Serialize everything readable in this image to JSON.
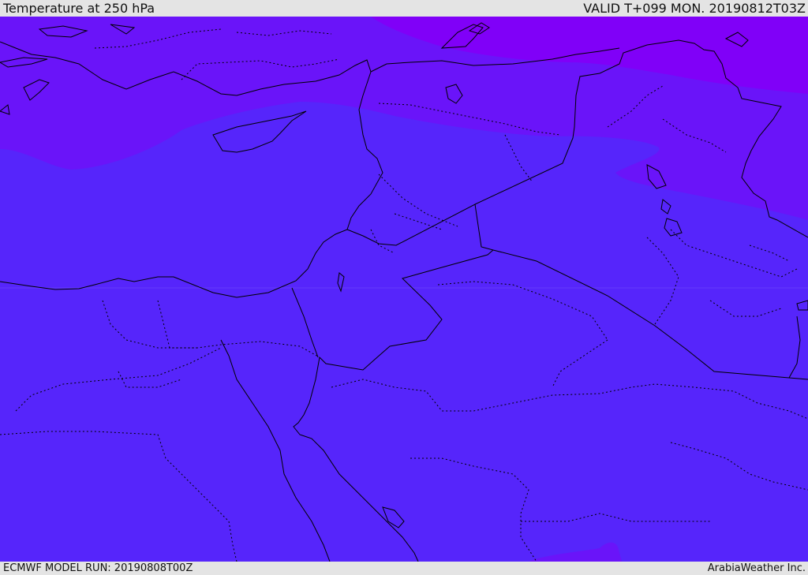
{
  "header": {
    "title": "Temperature at 250 hPa",
    "valid_time": "VALID T+099 MON. 20190812T03Z"
  },
  "footer": {
    "model_run": "ECMWF MODEL RUN: 20190808T00Z",
    "credit": "ArabiaWeather Inc."
  },
  "map": {
    "colors": {
      "base_band": "#5625fb",
      "cooler_band": "#6a14f9",
      "coldest_band": "#8000f8",
      "border_line": "#000000"
    }
  }
}
